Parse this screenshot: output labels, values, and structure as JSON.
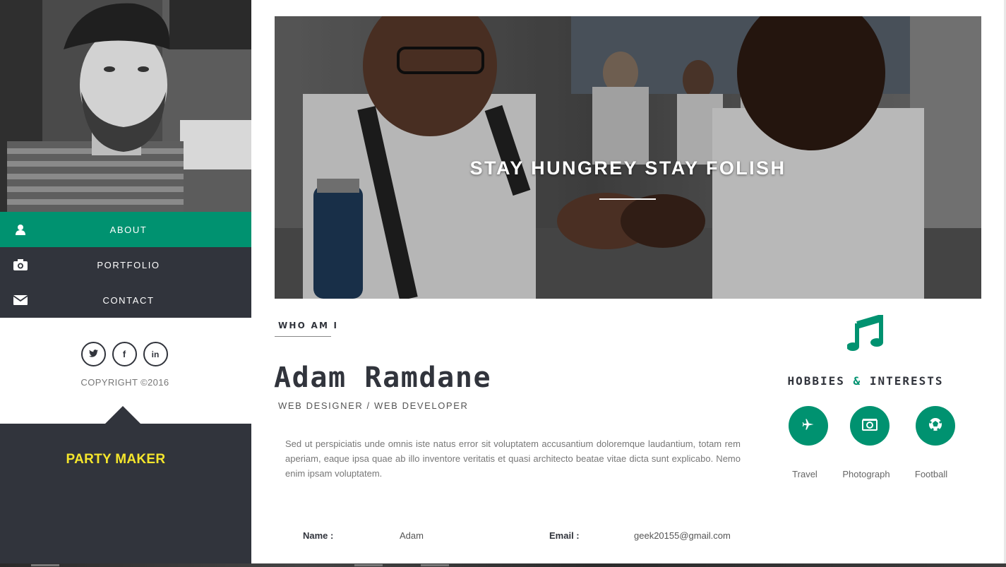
{
  "nav": {
    "items": [
      {
        "label": "ABOUT",
        "icon": "user-icon",
        "active": true
      },
      {
        "label": "PORTFOLIO",
        "icon": "camera-icon",
        "active": false
      },
      {
        "label": "CONTACT",
        "icon": "envelope-icon",
        "active": false
      }
    ]
  },
  "social": {
    "twitter": "t",
    "facebook": "f",
    "linkedin": "in"
  },
  "copyright": "COPYRIGHT ©2016",
  "party_label": "PARTY MAKER",
  "hero": {
    "title": "STAY HUNGREY STAY FOLISH"
  },
  "about": {
    "section_label": "WHO AM I",
    "name": "Adam Ramdane",
    "role": "WEB DESIGNER / WEB DEVELOPER",
    "bio": "Sed ut perspiciatis unde omnis iste natus error sit voluptatem accusantium doloremque laudantium, totam rem aperiam, eaque ipsa quae ab illo inventore veritatis et quasi architecto beatae vitae dicta sunt explicabo. Nemo enim ipsam voluptatem.",
    "info": {
      "name_key": "Name :",
      "name_value": "Adam",
      "email_key": "Email :",
      "email_value": "geek20155@gmail.com"
    }
  },
  "hobbies": {
    "title_part1": "HOBBIES",
    "title_amp": "&",
    "title_part2": "INTERESTS",
    "items": [
      {
        "label": "Travel",
        "icon": "plane-icon"
      },
      {
        "label": "Photograph",
        "icon": "photo-camera-icon"
      },
      {
        "label": "Football",
        "icon": "football-icon"
      }
    ]
  },
  "colors": {
    "accent": "#009270",
    "dark": "#31343c",
    "party": "#f5e62c"
  }
}
